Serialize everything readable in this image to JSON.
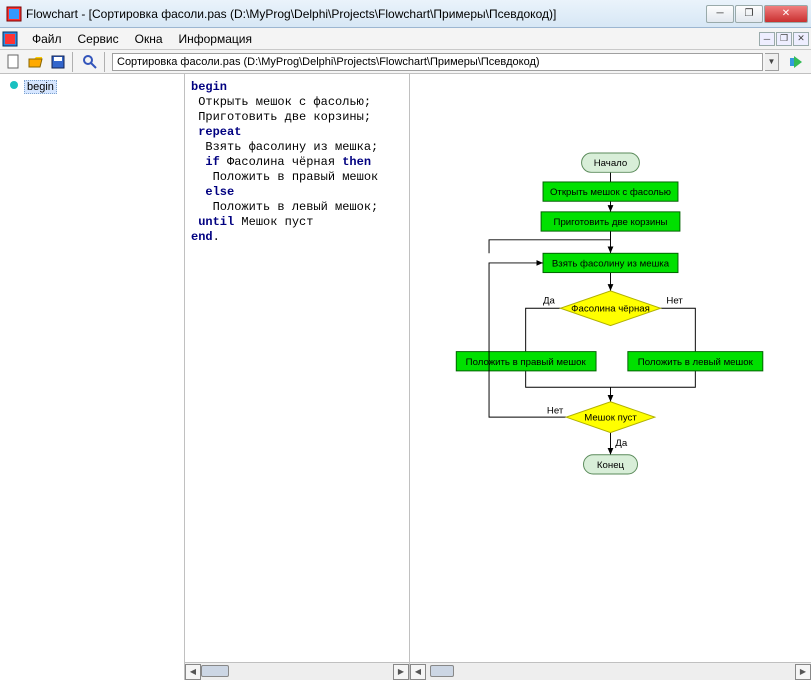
{
  "window": {
    "title": "Flowchart - [Сортировка фасоли.pas (D:\\MyProg\\Delphi\\Projects\\Flowchart\\Примеры\\Псевдокод)]"
  },
  "menu": {
    "file": "Файл",
    "service": "Сервис",
    "windows": "Окна",
    "info": "Информация"
  },
  "toolbar": {
    "path": "Сортировка фасоли.pas (D:\\MyProg\\Delphi\\Projects\\Flowchart\\Примеры\\Псевдокод)"
  },
  "tree": {
    "root": "begin"
  },
  "code": {
    "l1_kw": "begin",
    "l2": " Открыть мешок с фасолью;",
    "l3": " Приготовить две корзины;",
    "l4_kw": " repeat",
    "l5": "  Взять фасолину из мешка;",
    "l6a_kw": "  if",
    "l6b": " Фасолина чёрная ",
    "l6c_kw": "then",
    "l7": "   Положить в правый мешок",
    "l8_kw": "  else",
    "l9": "   Положить в левый мешок;",
    "l10a_kw": " until",
    "l10b": " Мешок пуст",
    "l11_kw": "end",
    "l11b": "."
  },
  "chart": {
    "start": "Начало",
    "n1": "Открыть мешок с фасолью",
    "n2": "Приготовить две корзины",
    "n3": "Взять фасолину из мешка",
    "d1": "Фасолина чёрная",
    "yes": "Да",
    "no": "Нет",
    "n4": "Положить в правый мешок",
    "n5": "Положить в левый мешок",
    "d2": "Мешок пуст",
    "end": "Конец"
  }
}
